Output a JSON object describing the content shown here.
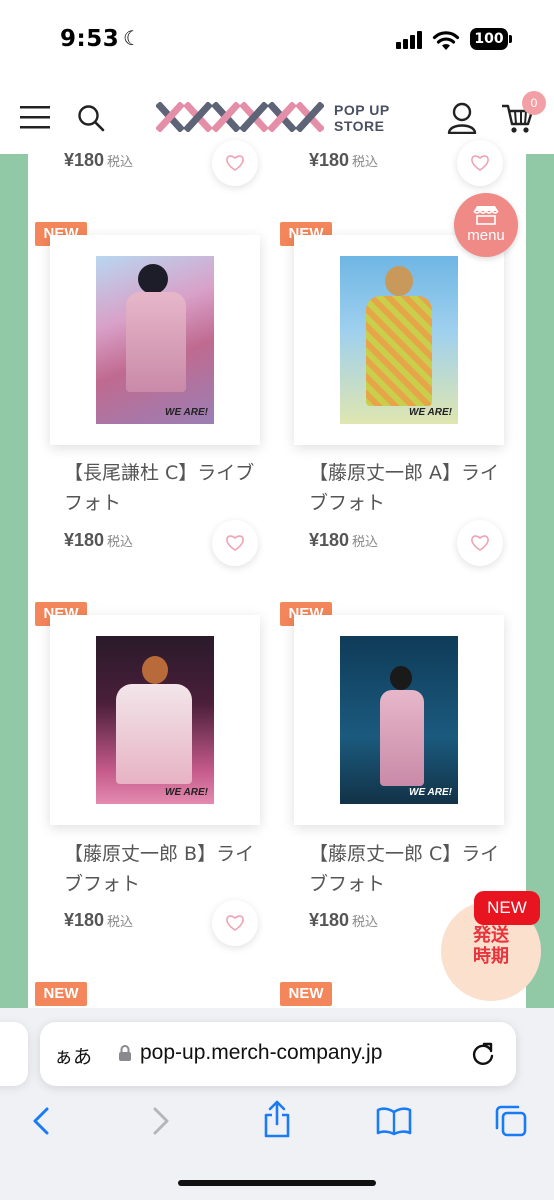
{
  "status_bar": {
    "time": "9:53",
    "battery": "100"
  },
  "header": {
    "logo_main": "×××××",
    "logo_line1": "POP UP",
    "logo_line2": "STORE",
    "cart_count": "0"
  },
  "float_menu_label": "menu",
  "shipping_badge": {
    "tag": "NEW",
    "line1": "発送",
    "line2": "時期"
  },
  "products": [
    {
      "badge": "",
      "name": "",
      "price": "¥180",
      "tax": "税込"
    },
    {
      "badge": "",
      "name": "",
      "price": "¥180",
      "tax": "税込"
    },
    {
      "badge": "NEW",
      "name": "【長尾謙杜 C】ライブフォト",
      "price": "¥180",
      "tax": "税込",
      "photo_text": "WE ARE!"
    },
    {
      "badge": "NEW",
      "name": "【藤原丈一郎 A】ライブフォト",
      "price": "¥180",
      "tax": "税込",
      "photo_text": "WE ARE!"
    },
    {
      "badge": "NEW",
      "name": "【藤原丈一郎 B】ライブフォト",
      "price": "¥180",
      "tax": "税込",
      "photo_text": "WE ARE!"
    },
    {
      "badge": "NEW",
      "name": "【藤原丈一郎 C】ライブフォト",
      "price": "¥180",
      "tax": "税込",
      "photo_text": "WE ARE!"
    },
    {
      "badge": "NEW"
    },
    {
      "badge": "NEW"
    }
  ],
  "browser": {
    "text_size_label": "ぁあ",
    "url": "pop-up.merch-company.jp"
  },
  "colors": {
    "accent": "#f3865a",
    "mint": "#91c9a7",
    "menu_circle": "#f08a86",
    "link_blue": "#1a7cf5"
  }
}
